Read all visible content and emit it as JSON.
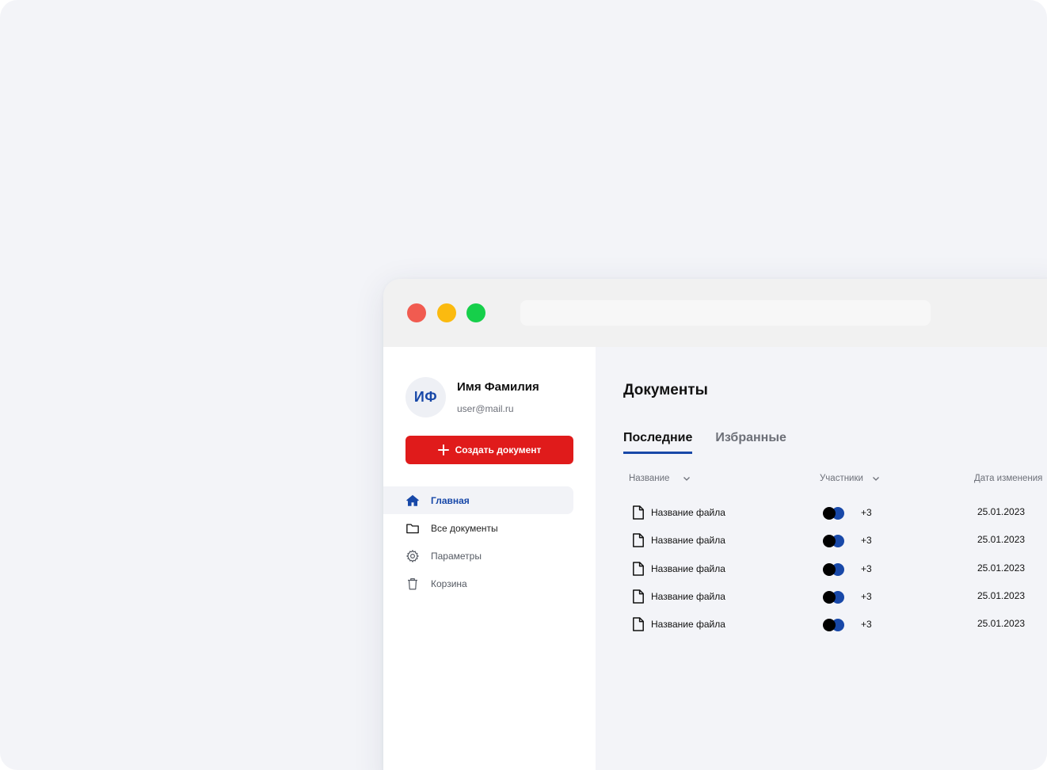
{
  "colors": {
    "background": "#f3f4f8",
    "accent": "#1848a8",
    "create_button": "#e01b1b",
    "traffic_red": "#f15b50",
    "traffic_yellow": "#fbba0f",
    "traffic_green": "#16cf4a",
    "avatar_dark": "#000000",
    "avatar_blue": "#1848a8"
  },
  "window": {
    "controls": [
      "close",
      "minimize",
      "maximize"
    ],
    "url": ""
  },
  "user": {
    "initials": "ИФ",
    "name": "Имя Фамилия",
    "email": "user@mail.ru"
  },
  "sidebar": {
    "create_label": "Создать документ",
    "items": [
      {
        "label": "Главная",
        "icon": "home-icon",
        "active": true
      },
      {
        "label": "Все документы",
        "icon": "folder-icon",
        "active": false
      },
      {
        "label": "Параметры",
        "icon": "gear-icon",
        "active": false
      },
      {
        "label": "Корзина",
        "icon": "trash-icon",
        "active": false
      }
    ]
  },
  "main": {
    "title": "Документы",
    "tabs": [
      {
        "label": "Последние",
        "active": true
      },
      {
        "label": "Избранные",
        "active": false
      }
    ],
    "columns": {
      "name": "Название",
      "participants": "Участники",
      "modified": "Дата изменения"
    },
    "rows": [
      {
        "name": "Название файла",
        "extra_participants": "+3",
        "date": "25.01.2023"
      },
      {
        "name": "Название файла",
        "extra_participants": "+3",
        "date": "25.01.2023"
      },
      {
        "name": "Название файла",
        "extra_participants": "+3",
        "date": "25.01.2023"
      },
      {
        "name": "Название файла",
        "extra_participants": "+3",
        "date": "25.01.2023"
      },
      {
        "name": "Название файла",
        "extra_participants": "+3",
        "date": "25.01.2023"
      }
    ]
  }
}
